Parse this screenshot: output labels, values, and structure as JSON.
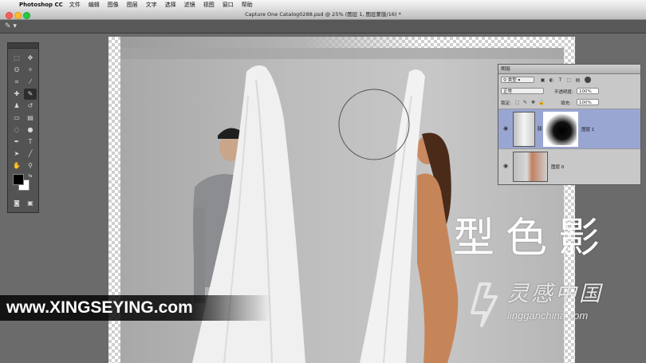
{
  "menubar": {
    "app_name": "Photoshop CC",
    "items": [
      "文件",
      "编辑",
      "图像",
      "图层",
      "文字",
      "选择",
      "滤镜",
      "视图",
      "窗口",
      "帮助"
    ]
  },
  "document": {
    "title": "Capture One Catalog0288.psd @ 25% (图层 1, 图层蒙版/16) *"
  },
  "layers_panel": {
    "tab": "图层",
    "filter_kind": "类型",
    "blend_mode": "正常",
    "opacity_label": "不透明度:",
    "opacity_value": "100%",
    "lock_label": "锁定:",
    "fill_label": "填充:",
    "fill_value": "100%",
    "layers": [
      {
        "name": "图层 1",
        "selected": true,
        "has_mask": true
      },
      {
        "name": "图层 0",
        "selected": false,
        "has_mask": false
      }
    ]
  },
  "overlay": {
    "brand_title": "型色影",
    "site_url": "www.XINGSEYING.com",
    "logo_cn": "灵感中国",
    "logo_url": "lingganchina.com"
  },
  "colors": {
    "foreground": "#000000",
    "background": "#ffffff",
    "layer_selected": "#9aa6d2"
  }
}
